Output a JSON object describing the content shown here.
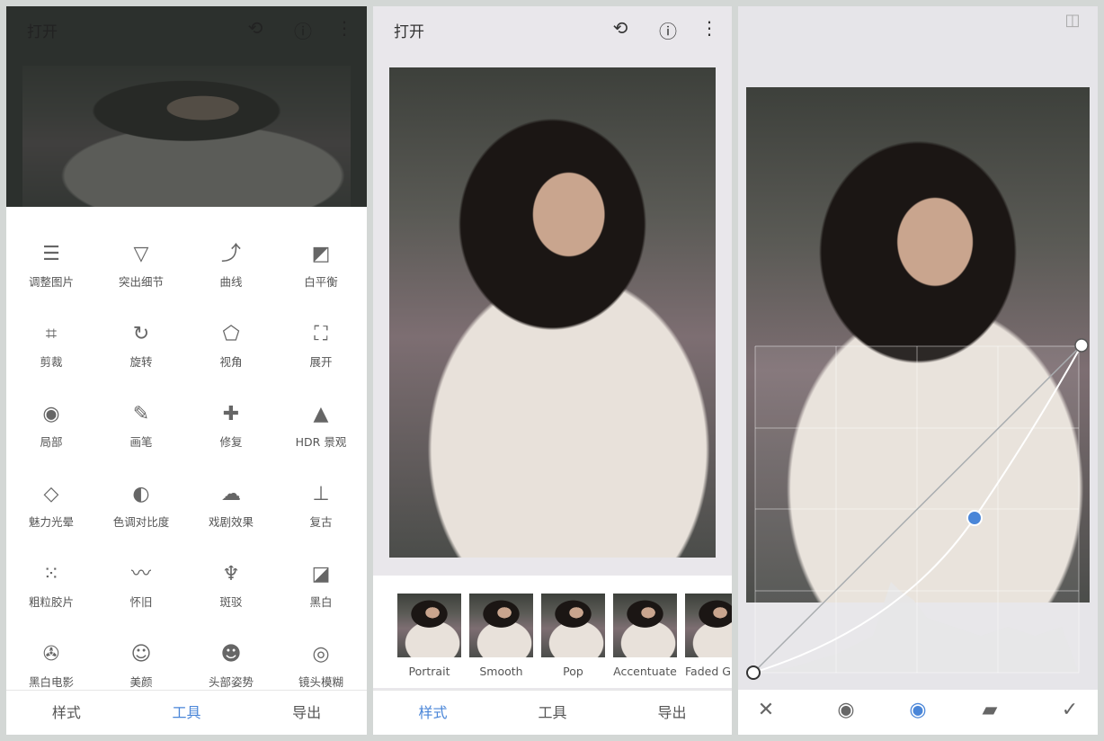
{
  "panel_tools": {
    "header": {
      "open_label": "打开",
      "icons": [
        "layers-undo-icon",
        "info-icon",
        "more-vert-icon"
      ]
    },
    "tools": [
      {
        "label": "调整图片",
        "icon": "tune-icon"
      },
      {
        "label": "突出细节",
        "icon": "details-triangle-icon"
      },
      {
        "label": "曲线",
        "icon": "curves-icon"
      },
      {
        "label": "白平衡",
        "icon": "white-balance-icon"
      },
      {
        "label": "剪裁",
        "icon": "crop-icon"
      },
      {
        "label": "旋转",
        "icon": "rotate-icon"
      },
      {
        "label": "视角",
        "icon": "perspective-icon"
      },
      {
        "label": "展开",
        "icon": "expand-icon"
      },
      {
        "label": "局部",
        "icon": "selective-icon"
      },
      {
        "label": "画笔",
        "icon": "brush-icon"
      },
      {
        "label": "修复",
        "icon": "healing-icon"
      },
      {
        "label": "HDR 景观",
        "icon": "mountain-icon"
      },
      {
        "label": "魅力光晕",
        "icon": "glamour-glow-icon"
      },
      {
        "label": "色调对比度",
        "icon": "tonal-contrast-icon"
      },
      {
        "label": "戏剧效果",
        "icon": "drama-cloud-icon"
      },
      {
        "label": "复古",
        "icon": "vintage-lamp-icon"
      },
      {
        "label": "粗粒胶片",
        "icon": "grainy-film-icon"
      },
      {
        "label": "怀旧",
        "icon": "mustache-icon"
      },
      {
        "label": "斑驳",
        "icon": "grunge-icon"
      },
      {
        "label": "黑白",
        "icon": "black-white-icon"
      },
      {
        "label": "黑白电影",
        "icon": "film-reel-icon"
      },
      {
        "label": "美颜",
        "icon": "face-icon"
      },
      {
        "label": "头部姿势",
        "icon": "head-pose-icon"
      },
      {
        "label": "镜头模糊",
        "icon": "lens-blur-icon"
      }
    ],
    "tabs": [
      "样式",
      "工具",
      "导出"
    ],
    "active_tab": "工具"
  },
  "panel_styles": {
    "header": {
      "open_label": "打开"
    },
    "styles": [
      "Portrait",
      "Smooth",
      "Pop",
      "Accentuate",
      "Faded Gl"
    ],
    "tabs": [
      "样式",
      "工具",
      "导出"
    ],
    "active_tab": "样式"
  },
  "panel_curves": {
    "toolbar": [
      "close-icon",
      "curve-channel-icon",
      "eye-icon",
      "presets-icon",
      "check-icon"
    ],
    "accent": "#4a86d8"
  }
}
